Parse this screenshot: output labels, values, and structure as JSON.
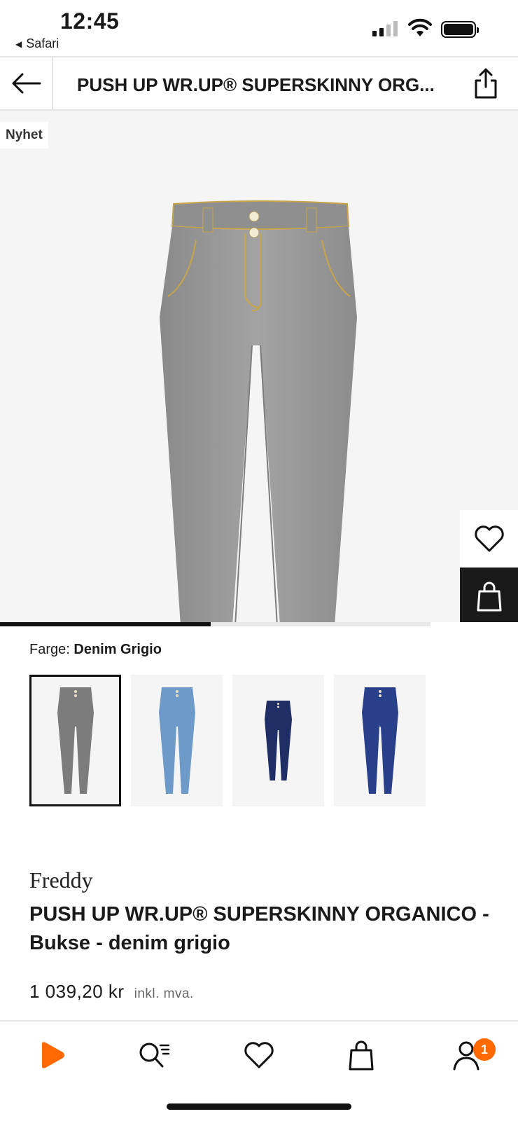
{
  "status_bar": {
    "time": "12:45",
    "back_app": "Safari",
    "back_app_icon": "left-triangle-icon"
  },
  "header": {
    "title": "PUSH UP WR.UP® SUPERSKINNY ORG...",
    "back_icon": "arrow-left-icon",
    "share_icon": "share-icon"
  },
  "hero": {
    "badge": "Nyhet",
    "wishlist_icon": "heart-icon",
    "add_to_bag_icon": "bag-icon",
    "gallery_progress": 0.49
  },
  "color": {
    "label": "Farge:",
    "value": "Denim Grigio",
    "variants": [
      {
        "name": "Denim Grigio",
        "selected": true,
        "tone": "#7c7c7c"
      },
      {
        "name": "light blue",
        "selected": false,
        "tone": "#6d9ac9"
      },
      {
        "name": "dark navy",
        "selected": false,
        "tone": "#1f2f66"
      },
      {
        "name": "indigo",
        "selected": false,
        "tone": "#283f8a"
      }
    ]
  },
  "product": {
    "brand": "Freddy",
    "name": "PUSH UP WR.UP® SUPERSKINNY ORGANICO - Bukse - denim grigio",
    "price": "1 039,20 kr",
    "vat_note": "inkl. mva."
  },
  "tabbar": {
    "items": [
      {
        "name": "home",
        "icon": "play-logo-icon"
      },
      {
        "name": "search",
        "icon": "search-icon"
      },
      {
        "name": "wishlist",
        "icon": "heart-icon"
      },
      {
        "name": "bag",
        "icon": "bag-icon"
      },
      {
        "name": "account",
        "icon": "user-icon"
      }
    ],
    "account_badge": "1"
  },
  "colors": {
    "brand_orange": "#ff6900",
    "text": "#1a1a1a",
    "image_bg": "#f5f5f5"
  }
}
